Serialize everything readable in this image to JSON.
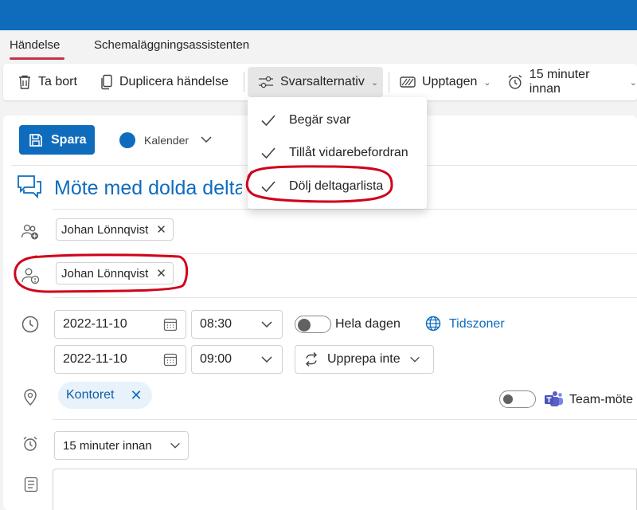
{
  "tabs": {
    "event": "Händelse",
    "scheduling": "Schemaläggningsassistenten"
  },
  "toolbar": {
    "delete": "Ta bort",
    "duplicate": "Duplicera händelse",
    "response_options": "Svarsalternativ",
    "busy": "Upptagen",
    "reminder": "15 minuter innan"
  },
  "response_menu": {
    "items": [
      {
        "label": "Begär svar",
        "checked": true
      },
      {
        "label": "Tillåt vidarebefordran",
        "checked": true
      },
      {
        "label": "Dölj deltagarlista",
        "checked": true
      }
    ]
  },
  "save_label": "Spara",
  "calendar": {
    "label": "Kalender",
    "color": "#0f6cbd"
  },
  "event_title": "Möte med dolda deltagare",
  "attendees": {
    "required": "Johan Lönnqvist",
    "optional": "Johan Lönnqvist"
  },
  "start": {
    "date": "2022-11-10",
    "time": "08:30"
  },
  "end": {
    "date": "2022-11-10",
    "time": "09:00"
  },
  "all_day_label": "Hela dagen",
  "timezones_label": "Tidszoner",
  "repeat_label": "Upprepa inte",
  "location": "Kontoret",
  "teams_label": "Team-möte",
  "reminder_value": "15 minuter innan",
  "colors": {
    "accent": "#0f6cbd",
    "annotation": "#d0021b",
    "teams": "#5b5fc7"
  }
}
